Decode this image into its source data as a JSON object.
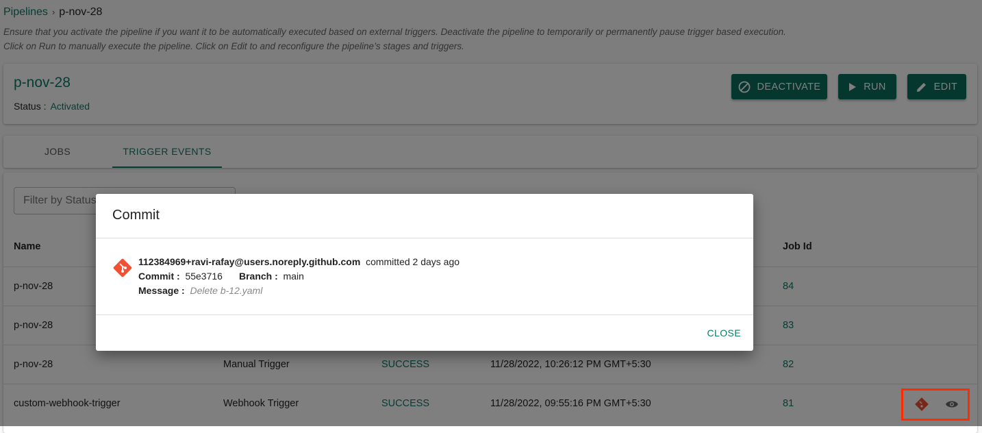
{
  "breadcrumb": {
    "root": "Pipelines",
    "current": "p-nov-28"
  },
  "description": [
    "Ensure that you activate the pipeline if you want it to be automatically executed based on external triggers. Deactivate the pipeline to temporarily or permanently pause trigger based execution.",
    "Click on Run to manually execute the pipeline. Click on Edit to and reconfigure the pipeline’s stages and triggers."
  ],
  "pipeline": {
    "name": "p-nov-28",
    "status_label": "Status :",
    "status": "Activated"
  },
  "buttons": {
    "deactivate": "DEACTIVATE",
    "run": "RUN",
    "edit": "EDIT"
  },
  "tabs": [
    {
      "label": "JOBS"
    },
    {
      "label": "TRIGGER EVENTS",
      "active": true
    }
  ],
  "filter": {
    "placeholder": "Filter by Status"
  },
  "table": {
    "headers": {
      "name": "Name",
      "job_id": "Job Id"
    },
    "rows": [
      {
        "name": "p-nov-28",
        "job_id": "84"
      },
      {
        "name": "p-nov-28",
        "job_id": "83"
      },
      {
        "name": "p-nov-28",
        "type": "Manual Trigger",
        "status": "SUCCESS",
        "time": "11/28/2022, 10:26:12 PM GMT+5:30",
        "job_id": "82"
      },
      {
        "name": "custom-webhook-trigger",
        "type": "Webhook Trigger",
        "status": "SUCCESS",
        "time": "11/28/2022, 09:55:16 PM GMT+5:30",
        "job_id": "81"
      }
    ]
  },
  "modal": {
    "title": "Commit",
    "author": "112384969+ravi-rafay@users.noreply.github.com",
    "when": "committed 2 days ago",
    "commit_label": "Commit :",
    "commit": "55e3716",
    "branch_label": "Branch :",
    "branch": "main",
    "message_label": "Message :",
    "message": "Delete b-12.yaml",
    "close": "CLOSE"
  },
  "colors": {
    "accent": "#0a7a66",
    "git": "#f05033",
    "highlight": "#ff2a00"
  }
}
